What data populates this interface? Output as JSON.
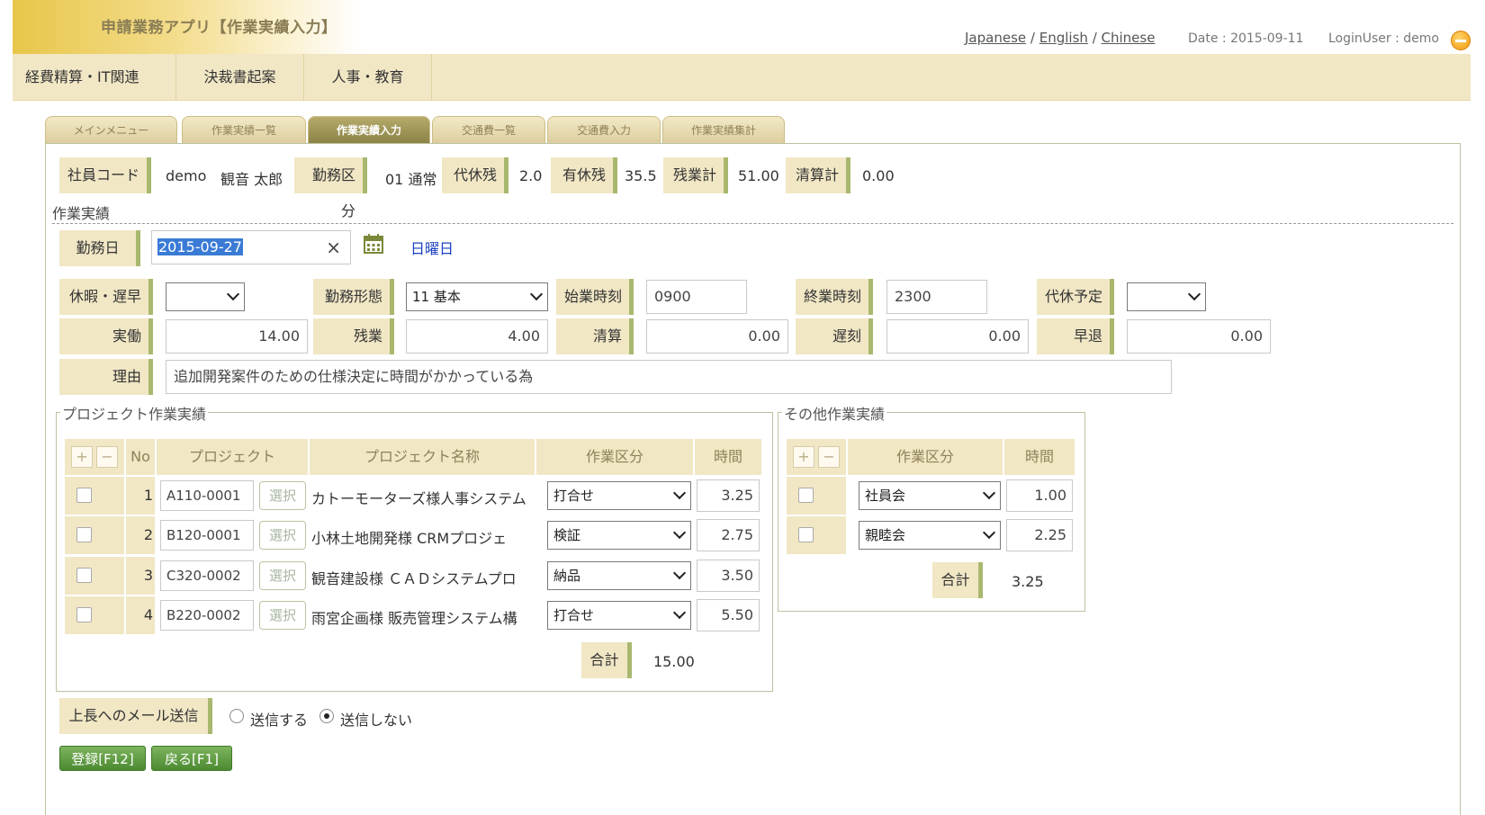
{
  "header": {
    "app_title": "申請業務アプリ【作業実績入力】",
    "lang": {
      "ja": "Japanese",
      "en": "English",
      "zh": "Chinese",
      "sep": "/"
    },
    "date": "Date : 2015-09-11",
    "login_user": "LoginUser : demo"
  },
  "nav": [
    "経費精算・IT関連",
    "決裁書起案",
    "人事・教育"
  ],
  "tabs": [
    "メインメニュー",
    "作業実績一覧",
    "作業実績入力",
    "交通費一覧",
    "交通費入力",
    "作業実績集計"
  ],
  "summary": {
    "emp_code_label": "社員コード",
    "emp_code": "demo",
    "emp_name": "観音 太郎",
    "work_div_label": "勤務区分",
    "work_div": "01 通常",
    "comp_rest_label": "代休残",
    "comp_rest": "2.0",
    "paid_rest_label": "有休残",
    "paid_rest": "35.5",
    "overtime_label": "残業計",
    "overtime": "51.00",
    "settle_label": "清算計",
    "settle": "0.00"
  },
  "section_title": "作業実績",
  "form": {
    "work_date_label": "勤務日",
    "work_date": "2015-09-27",
    "clear_glyph": "×",
    "weekday": "日曜日",
    "leave_label": "休暇・遅早",
    "leave_value": "",
    "work_type_label": "勤務形態",
    "work_type": "11 基本",
    "start_label": "始業時刻",
    "start": "0900",
    "end_label": "終業時刻",
    "end": "2300",
    "comp_plan_label": "代休予定",
    "comp_plan": "",
    "actual_label": "実働",
    "actual": "14.00",
    "overtime_label": "残業",
    "overtime": "4.00",
    "settle_label": "清算",
    "settle": "0.00",
    "late_label": "遅刻",
    "late": "0.00",
    "early_label": "早退",
    "early": "0.00",
    "reason_label": "理由",
    "reason": "追加開発案件のための仕様決定に時間がかかっている為"
  },
  "project": {
    "legend": "プロジェクト作業実績",
    "headers": {
      "no": "No",
      "project": "プロジェクト",
      "name": "プロジェクト名称",
      "kind": "作業区分",
      "time": "時間"
    },
    "plus": "+",
    "minus": "−",
    "select_label": "選択",
    "rows": [
      {
        "no": "1",
        "code": "A110-0001",
        "name": "カトーモーターズ様人事システム",
        "kind": "打合せ",
        "time": "3.25"
      },
      {
        "no": "2",
        "code": "B120-0001",
        "name": "小林土地開発様 CRMプロジェ",
        "kind": "検証",
        "time": "2.75"
      },
      {
        "no": "3",
        "code": "C320-0002",
        "name": "観音建設様 ＣＡＤシステムプロ",
        "kind": "納品",
        "time": "3.50"
      },
      {
        "no": "4",
        "code": "B220-0002",
        "name": "雨宮企画様 販売管理システム構",
        "kind": "打合せ",
        "time": "5.50"
      }
    ],
    "total_label": "合計",
    "total": "15.00"
  },
  "other": {
    "legend": "その他作業実績",
    "headers": {
      "kind": "作業区分",
      "time": "時間"
    },
    "plus": "+",
    "minus": "−",
    "rows": [
      {
        "kind": "社員会",
        "time": "1.00"
      },
      {
        "kind": "親睦会",
        "time": "2.25"
      }
    ],
    "total_label": "合計",
    "total": "3.25"
  },
  "mail": {
    "label": "上長へのメール送信",
    "send": "送信する",
    "nosend": "送信しない",
    "selected": "送信しない"
  },
  "buttons": {
    "register": "登録[F12]",
    "back": "戻る[F1]"
  }
}
